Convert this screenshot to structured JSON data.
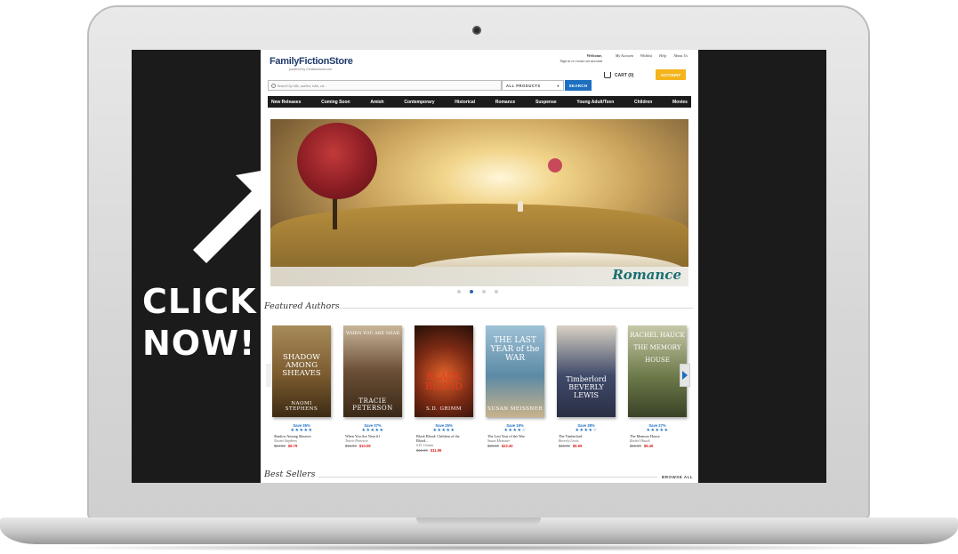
{
  "promo": {
    "cta": "CLICK\nNOW!"
  },
  "site": {
    "logo": {
      "main": "FamilyFictionStore",
      "sub": "powered by Christianbook.com"
    },
    "welcome": {
      "title": "Welcome,",
      "subtitle": "Sign in or create an account"
    },
    "top_links": [
      "My Account",
      "Wishlist",
      "Help",
      "About Us"
    ],
    "cart_label": "CART (0)",
    "account_label": "ACCOUNT",
    "search": {
      "placeholder": "Search by title, author, isbn, etc.",
      "scope": "ALL PRODUCTS",
      "button": "SEARCH"
    },
    "nav": [
      "New Releases",
      "Coming Soon",
      "Amish",
      "Contemporary",
      "Historical",
      "Romance",
      "Suspense",
      "Young Adult/Teen",
      "Children",
      "Movies"
    ],
    "hero": {
      "label": "Romance",
      "slide_count": 4,
      "active_slide": 1
    },
    "featured": {
      "title": "Featured Authors",
      "books": [
        {
          "cover_title": "SHADOW AMONG SHEAVES",
          "cover_author": "NAOMI STEPHENS",
          "save": "Save 35%",
          "stars": "★★★★★",
          "title": "Shadow Among Sheaves",
          "author": "Naomi Stephens",
          "old_price": "$14.99",
          "price": "$9.79",
          "cover_color": "#7a5a2e"
        },
        {
          "cover_title": "WHEN YOU ARE NEAR",
          "cover_author": "TRACIE PETERSON",
          "save": "Save 37%",
          "stars": "★★★★★",
          "title": "When You Are Near #1",
          "author": "Tracie Peterson",
          "old_price": "$15.99",
          "price": "$10.09",
          "cover_color": "#6b4f36"
        },
        {
          "cover_title": "BLACK BLOOD",
          "cover_author": "S.D. GRIMM",
          "save": "Save 25%",
          "stars": "★★★★★",
          "title": "Black Blood: Children of the Blood...",
          "author": "S.D. Grimm",
          "old_price": "$15.99",
          "price": "$11.99",
          "cover_color": "#7c2a14"
        },
        {
          "cover_title": "THE LAST YEAR of the WAR",
          "cover_author": "SUSAN MEISSNER",
          "save": "Save 19%",
          "stars": "★★★★☆",
          "title": "The Last Year of the War",
          "author": "Susan Meissner",
          "old_price": "$28.00",
          "price": "$22.40",
          "cover_color": "#5c8aa6"
        },
        {
          "cover_title": "Timberlord BEVERLY LEWIS",
          "cover_author": "",
          "save": "Save 38%",
          "stars": "★★★★☆",
          "title": "The Timberlord",
          "author": "Beverly Lewis",
          "old_price": "$15.99",
          "price": "$9.99",
          "cover_color": "#3f4a6a"
        },
        {
          "cover_title": "RACHEL HAUCK THE MEMORY HOUSE",
          "cover_author": "",
          "save": "Save 27%",
          "stars": "★★★★★",
          "title": "The Memory House",
          "author": "Rachel Hauck",
          "old_price": "$15.99",
          "price": "$9.49",
          "cover_color": "#6d7a4a"
        }
      ]
    },
    "best_sellers": {
      "title": "Best Sellers",
      "browse_all": "BROWSE ALL"
    }
  }
}
